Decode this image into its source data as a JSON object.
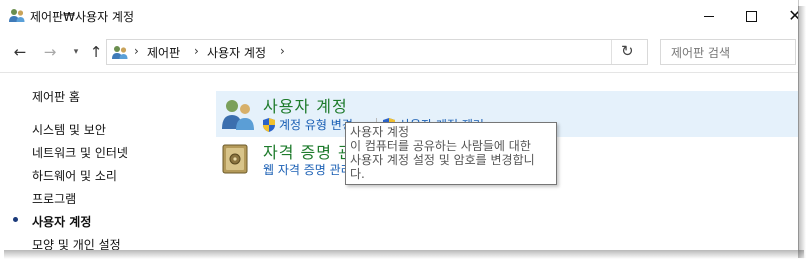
{
  "window": {
    "title": "제어판₩사용자 계정"
  },
  "nav": {
    "back_icon": "arrow-left-icon",
    "forward_icon": "arrow-right-icon",
    "recent_icon": "chevron-down-icon",
    "up_icon": "arrow-up-icon"
  },
  "address": {
    "crumbs": [
      "제어판",
      "사용자 계정"
    ],
    "separator": "›"
  },
  "search": {
    "placeholder": "제어판 검색"
  },
  "sidebar": {
    "items": [
      {
        "label": "제어판 홈",
        "active": false
      },
      {
        "label": "시스템 및 보안",
        "active": false
      },
      {
        "label": "네트워크 및 인터넷",
        "active": false
      },
      {
        "label": "하드웨어 및 소리",
        "active": false
      },
      {
        "label": "프로그램",
        "active": false
      },
      {
        "label": "사용자 계정",
        "active": true
      },
      {
        "label": "모양 및 개인 설정",
        "active": false
      }
    ]
  },
  "main": {
    "categories": [
      {
        "title": "사용자 계정",
        "icon": "users-icon",
        "links": [
          "계정 유형 변경",
          "사용자 계정 제거"
        ]
      },
      {
        "title": "자격 증명 관리자",
        "icon": "credential-safe-icon",
        "links": [
          "웹 자격 증명 관리"
        ]
      }
    ]
  },
  "tooltip": {
    "title": "사용자 계정",
    "line1": "이 컴퓨터를 공유하는 사람들에 대한",
    "line2": "사용자 계정 설정 및 암호를 변경합니",
    "line3": "다."
  },
  "colors": {
    "category_title": "#1e7b2c",
    "link": "#1a5fb4",
    "hover_background": "#e5f1fb"
  }
}
